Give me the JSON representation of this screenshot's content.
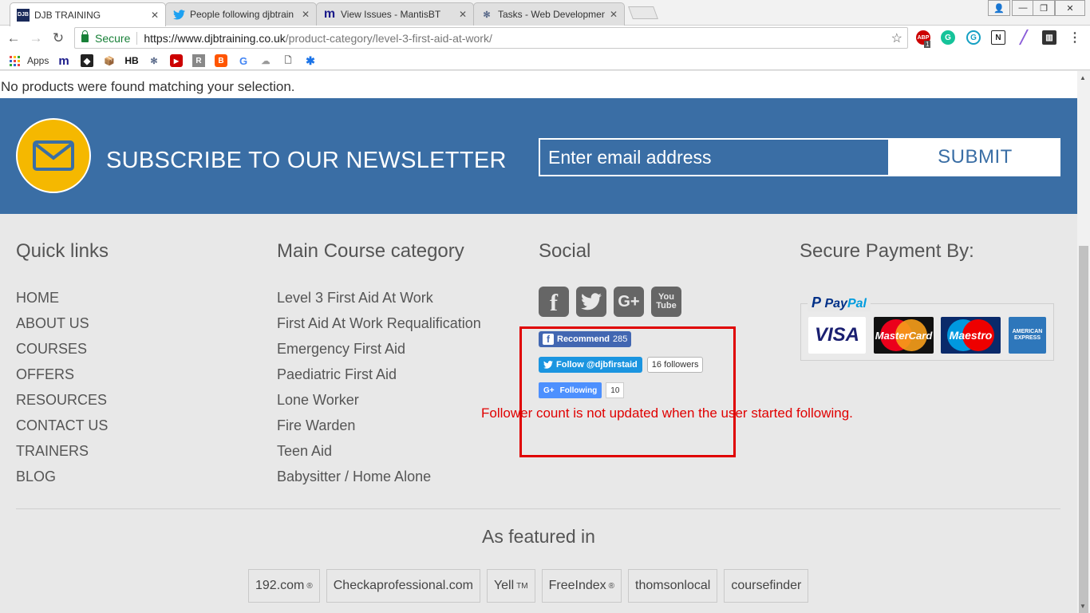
{
  "browser": {
    "tabs": [
      {
        "title": "DJB TRAINING",
        "icon": "djb-favicon",
        "active": true
      },
      {
        "title": "People following djbtrain",
        "icon": "twitter-favicon",
        "active": false
      },
      {
        "title": "View Issues - MantisBT",
        "icon": "mantis-favicon",
        "active": false
      },
      {
        "title": "Tasks - Web Developmen",
        "icon": "tasks-favicon",
        "active": false
      }
    ],
    "secure_label": "Secure",
    "url_host": "https://www.djbtraining.co.uk",
    "url_path": "/product-category/level-3-first-aid-at-work/",
    "bookmarks_apps_label": "Apps",
    "abp_badge": "1"
  },
  "page": {
    "notice": "No products were found matching your selection.",
    "newsletter": {
      "title": "SUBSCRIBE TO OUR NEWSLETTER",
      "email_placeholder": "Enter email address",
      "submit_label": "SUBMIT",
      "accent_color": "#f5b800",
      "band_color": "#3a6ea5"
    },
    "quick_links": {
      "title": "Quick links",
      "items": [
        "HOME",
        "ABOUT US",
        "COURSES",
        "OFFERS",
        "RESOURCES",
        "CONTACT US",
        "TRAINERS",
        "BLOG"
      ]
    },
    "main_courses": {
      "title": "Main Course category",
      "items": [
        "Level 3 First Aid At Work",
        "First Aid At Work Requalification",
        "Emergency First Aid",
        "Paediatric First Aid",
        "Lone Worker",
        "Fire Warden",
        "Teen Aid",
        "Babysitter / Home Alone"
      ]
    },
    "social": {
      "title": "Social",
      "icons": [
        "facebook-icon",
        "twitter-icon",
        "google-plus-icon",
        "youtube-icon"
      ],
      "fb_recommend_label": "Recommend",
      "fb_recommend_count": "285",
      "twitter_follow_label": "Follow @djbfirstaid",
      "twitter_followers": "16 followers",
      "gplus_label": "Following",
      "gplus_count": "10"
    },
    "payment": {
      "title": "Secure Payment By:",
      "paypal_part1": "Pay",
      "paypal_part2": "Pal",
      "cards": [
        "VISA",
        "MasterCard",
        "Maestro",
        "AMERICAN EXPRESS"
      ]
    },
    "annotation": "Follower count is not updated when the user started following.",
    "featured": {
      "title": "As featured in",
      "items": [
        {
          "label": "192.com",
          "mark": "®"
        },
        {
          "label": "Checkaprofessional.com",
          "mark": ""
        },
        {
          "label": "Yell",
          "mark": "TM"
        },
        {
          "label": "FreeIndex",
          "mark": "®"
        },
        {
          "label": "thomsonlocal",
          "mark": ""
        },
        {
          "label": "coursefinder",
          "mark": ""
        }
      ]
    }
  }
}
